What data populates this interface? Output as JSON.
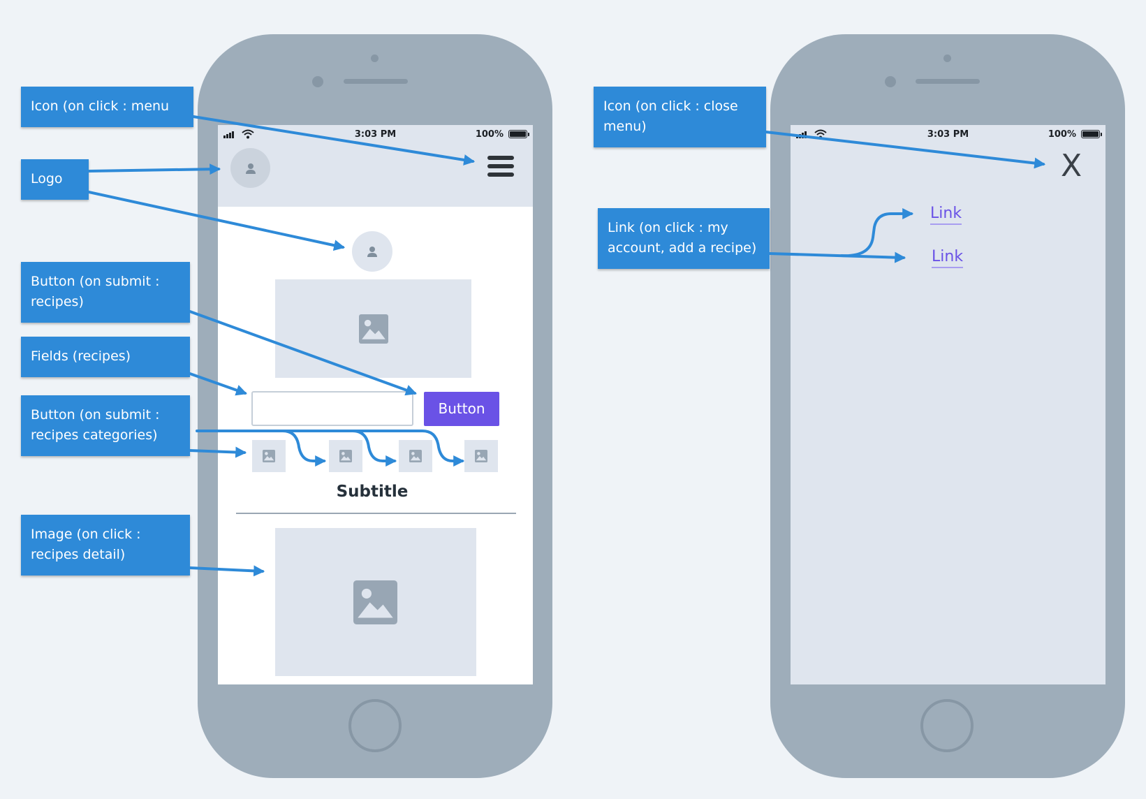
{
  "left_phone": {
    "status": {
      "time": "3:03 PM",
      "battery": "100%"
    },
    "subtitle": "Subtitle",
    "search_button_label": "Button",
    "search_field_value": ""
  },
  "right_phone": {
    "status": {
      "time": "3:03 PM",
      "battery": "100%"
    },
    "close_icon_glyph": "X",
    "links": [
      {
        "label": "Link"
      },
      {
        "label": "Link"
      }
    ]
  },
  "callouts": [
    {
      "text": "Icon (on click : menu"
    },
    {
      "text": "Logo"
    },
    {
      "text": "Button (on submit :\nrecipes)"
    },
    {
      "text": "Fields (recipes)"
    },
    {
      "text": "Button (on submit :\nrecipes categories)"
    },
    {
      "text": "Image (on click :\nrecipes detail)"
    },
    {
      "text": "Icon (on click : close\nmenu)"
    },
    {
      "text": "Link (on click : my\naccount, add a recipe)"
    }
  ],
  "colors": {
    "background": "#eff3f7",
    "phone": "#9eadba",
    "callout": "#2e8ad8",
    "arrow": "#2e8ad8",
    "primary_button": "#6a52e6",
    "link": "#6a52e6",
    "placeholder": "#dfe5ee"
  }
}
